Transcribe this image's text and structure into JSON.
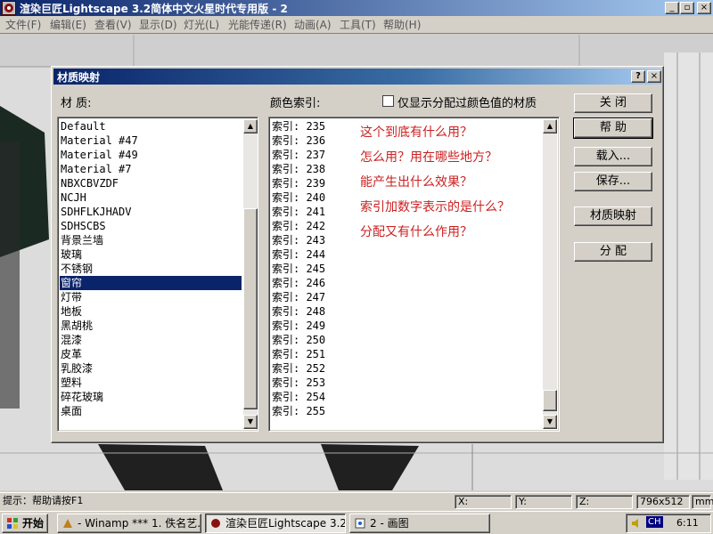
{
  "app": {
    "title": "渲染巨匠Lightscape 3.2简体中文火星时代专用版 - 2",
    "caption_buttons": [
      "_",
      "▫",
      "×"
    ]
  },
  "menu": [
    {
      "label": "文件(F)"
    },
    {
      "label": "编辑(E)"
    },
    {
      "label": "查看(V)"
    },
    {
      "label": "显示(D)"
    },
    {
      "label": "灯光(L)"
    },
    {
      "label": "光能传递(R)"
    },
    {
      "label": "动画(A)"
    },
    {
      "label": "工具(T)"
    },
    {
      "label": "帮助(H)"
    }
  ],
  "dialog": {
    "title": "材质映射",
    "help_glyph": "?",
    "close_glyph": "×",
    "material_label": "材  质:",
    "color_index_label": "颜色索引:",
    "checkbox_label": "仅显示分配过颜色值的材质",
    "checkbox_checked": false,
    "materials": [
      "Default",
      "Material #47",
      "Material #49",
      "Material #7",
      "NBXCBVZDF",
      "NCJH",
      "SDHFLKJHADV",
      "SDHSCBS",
      "背景兰墙",
      "玻璃",
      "不锈钢",
      "窗帘",
      "灯带",
      "地板",
      "黑胡桃",
      "混漆",
      "皮革",
      "乳胶漆",
      "塑料",
      "碎花玻璃",
      "桌面"
    ],
    "selected_material": "窗帘",
    "color_indices": [
      "索引: 235",
      "索引: 236",
      "索引: 237",
      "索引: 238",
      "索引: 239",
      "索引: 240",
      "索引: 241",
      "索引: 242",
      "索引: 243",
      "索引: 244",
      "索引: 245",
      "索引: 246",
      "索引: 247",
      "索引: 248",
      "索引: 249",
      "索引: 250",
      "索引: 251",
      "索引: 252",
      "索引: 253",
      "索引: 254",
      "索引: 255"
    ],
    "annotations": [
      "这个到底有什么用？",
      "怎么用？用在哪些地方？",
      "能产生出什么效果？",
      "索引加数字表示的是什么？",
      "分配又有什么作用？"
    ],
    "annotation_color": "#cc2020",
    "buttons": {
      "close": "关  闭",
      "help": "帮  助",
      "load": "载入...",
      "save": "保存...",
      "material_map": "材质映射",
      "assign": "分  配"
    },
    "scroll_up_glyph": "▲",
    "scroll_down_glyph": "▼"
  },
  "statusbar": {
    "hint": "提示：帮助请按F1",
    "x_label": "X:",
    "y_label": "Y:",
    "z_label": "Z:",
    "resolution": "796x512",
    "unit": "mm"
  },
  "taskbar": {
    "start": "开始",
    "tasks": [
      {
        "label": "- Winamp *** 1. 佚名艺..."
      },
      {
        "label": "渲染巨匠Lightscape 3.2..."
      },
      {
        "label": "2 - 画图"
      }
    ],
    "ime": "CH",
    "clock": "6:11"
  },
  "colors": {
    "title_active": "#0a246a",
    "selection": "#0a246a",
    "face": "#d4d0c8"
  }
}
